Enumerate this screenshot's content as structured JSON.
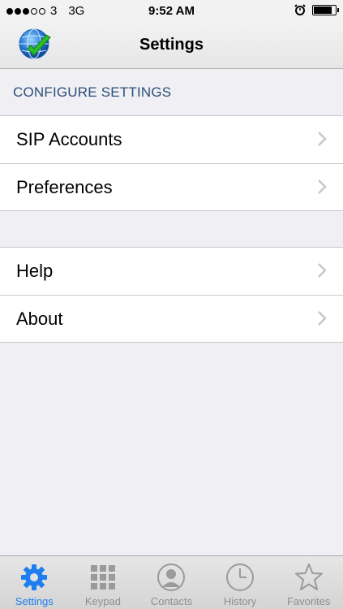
{
  "status": {
    "carrier": "3",
    "network": "3G",
    "time": "9:52 AM",
    "battery_level": 0.85
  },
  "nav": {
    "title": "Settings"
  },
  "section": {
    "header": "CONFIGURE SETTINGS"
  },
  "group1": [
    {
      "label": "SIP Accounts"
    },
    {
      "label": "Preferences"
    }
  ],
  "group2": [
    {
      "label": "Help"
    },
    {
      "label": "About"
    }
  ],
  "tabs": [
    {
      "label": "Settings",
      "icon": "gear-icon",
      "active": true
    },
    {
      "label": "Keypad",
      "icon": "keypad-icon",
      "active": false
    },
    {
      "label": "Contacts",
      "icon": "contact-icon",
      "active": false
    },
    {
      "label": "History",
      "icon": "clock-icon",
      "active": false
    },
    {
      "label": "Favorites",
      "icon": "star-icon",
      "active": false
    }
  ],
  "colors": {
    "accent": "#1e7ef0",
    "section_header": "#2c4f7a",
    "background": "#efeff4"
  }
}
